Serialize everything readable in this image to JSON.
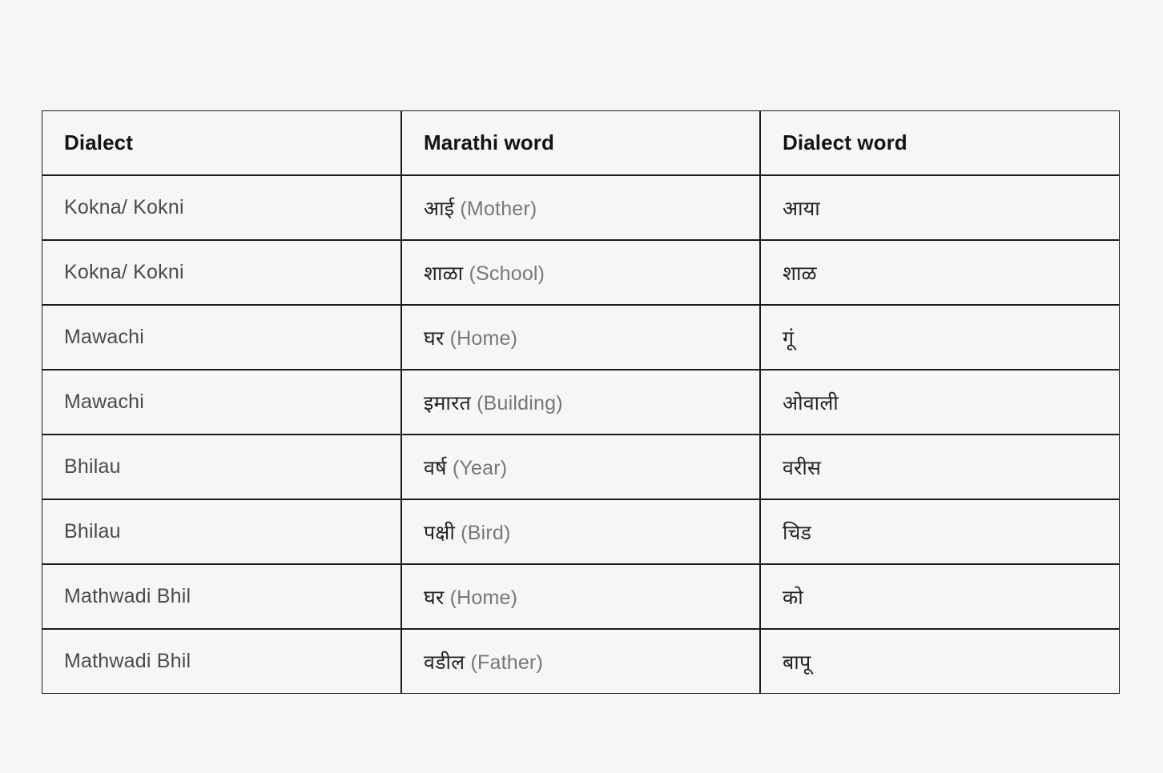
{
  "table": {
    "columns": [
      {
        "key": "dialect",
        "label": "Dialect"
      },
      {
        "key": "marathi_word",
        "label": "Marathi word"
      },
      {
        "key": "dialect_word",
        "label": "Dialect word"
      }
    ],
    "rows": [
      {
        "dialect": "Kokna/ Kokni",
        "marathi_native": "आई",
        "marathi_gloss": "(Mother)",
        "marathi_word": "आई (Mother)",
        "dialect_word": "आया"
      },
      {
        "dialect": "Kokna/ Kokni",
        "marathi_native": "शाळा",
        "marathi_gloss": "(School)",
        "marathi_word": "शाळा (School)",
        "dialect_word": "शाळ"
      },
      {
        "dialect": "Mawachi",
        "marathi_native": "घर",
        "marathi_gloss": "(Home)",
        "marathi_word": "घर (Home)",
        "dialect_word": "गूं"
      },
      {
        "dialect": "Mawachi",
        "marathi_native": "इमारत",
        "marathi_gloss": "(Building)",
        "marathi_word": "इमारत (Building)",
        "dialect_word": "ओवाली"
      },
      {
        "dialect": "Bhilau",
        "marathi_native": "वर्ष",
        "marathi_gloss": "(Year)",
        "marathi_word": "वर्ष (Year)",
        "dialect_word": "वरीस"
      },
      {
        "dialect": "Bhilau",
        "marathi_native": "पक्षी",
        "marathi_gloss": "(Bird)",
        "marathi_word": "पक्षी (Bird)",
        "dialect_word": "चिड"
      },
      {
        "dialect": "Mathwadi Bhil",
        "marathi_native": "घर",
        "marathi_gloss": "(Home)",
        "marathi_word": "घर (Home)",
        "dialect_word": "को"
      },
      {
        "dialect": "Mathwadi Bhil",
        "marathi_native": "वडील",
        "marathi_gloss": "(Father)",
        "marathi_word": "वडील (Father)",
        "dialect_word": "बापू"
      }
    ]
  },
  "colors": {
    "page_background": "#f6f6f6",
    "cell_background": "#f6f6f6",
    "border": "#1c1c1c",
    "header_text": "#131313",
    "body_text": "#4a4a4a",
    "gloss_text": "#777777",
    "native_text": "#232323"
  }
}
